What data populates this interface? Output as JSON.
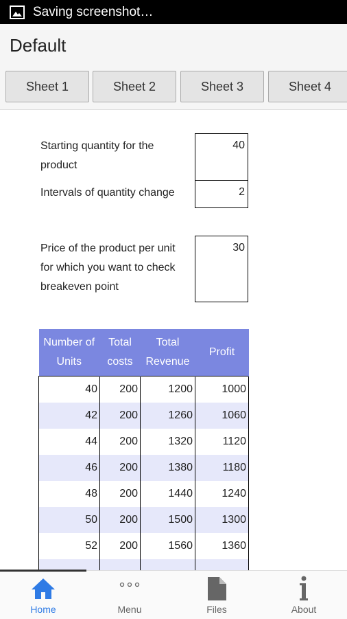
{
  "status_bar": {
    "text": "Saving screenshot…"
  },
  "app_bar": {
    "title": "Default"
  },
  "tabs": [
    "Sheet 1",
    "Sheet 2",
    "Sheet 3",
    "Sheet 4"
  ],
  "inputs": {
    "starting_quantity": {
      "label_line1": "Starting quantity for the",
      "label_line2": "product",
      "value": "40"
    },
    "interval": {
      "label": "Intervals of quantity change",
      "value": "2"
    },
    "price": {
      "label_line1": "Price of the product per unit",
      "label_line2": "for which you want to check",
      "label_line3": "breakeven point",
      "value": "30"
    }
  },
  "table": {
    "headers": [
      {
        "line1": "Number of",
        "line2": "Units"
      },
      {
        "line1": "Total",
        "line2": "costs"
      },
      {
        "line1": "Total",
        "line2": "Revenue"
      },
      {
        "line1": "Profit",
        "line2": ""
      }
    ],
    "rows": [
      [
        "40",
        "200",
        "1200",
        "1000"
      ],
      [
        "42",
        "200",
        "1260",
        "1060"
      ],
      [
        "44",
        "200",
        "1320",
        "1120"
      ],
      [
        "46",
        "200",
        "1380",
        "1180"
      ],
      [
        "48",
        "200",
        "1440",
        "1240"
      ],
      [
        "50",
        "200",
        "1500",
        "1300"
      ],
      [
        "52",
        "200",
        "1560",
        "1360"
      ]
    ],
    "colors": {
      "header_bg": "#7b87e0",
      "alt_row_bg": "#e6e8fa"
    }
  },
  "bottom_nav": {
    "items": [
      {
        "label": "Home",
        "icon": "home-icon",
        "active": true
      },
      {
        "label": "Menu",
        "icon": "more-dots-icon",
        "active": false
      },
      {
        "label": "Files",
        "icon": "file-icon",
        "active": false
      },
      {
        "label": "About",
        "icon": "info-icon",
        "active": false
      }
    ],
    "active_color": "#2f7be5"
  }
}
